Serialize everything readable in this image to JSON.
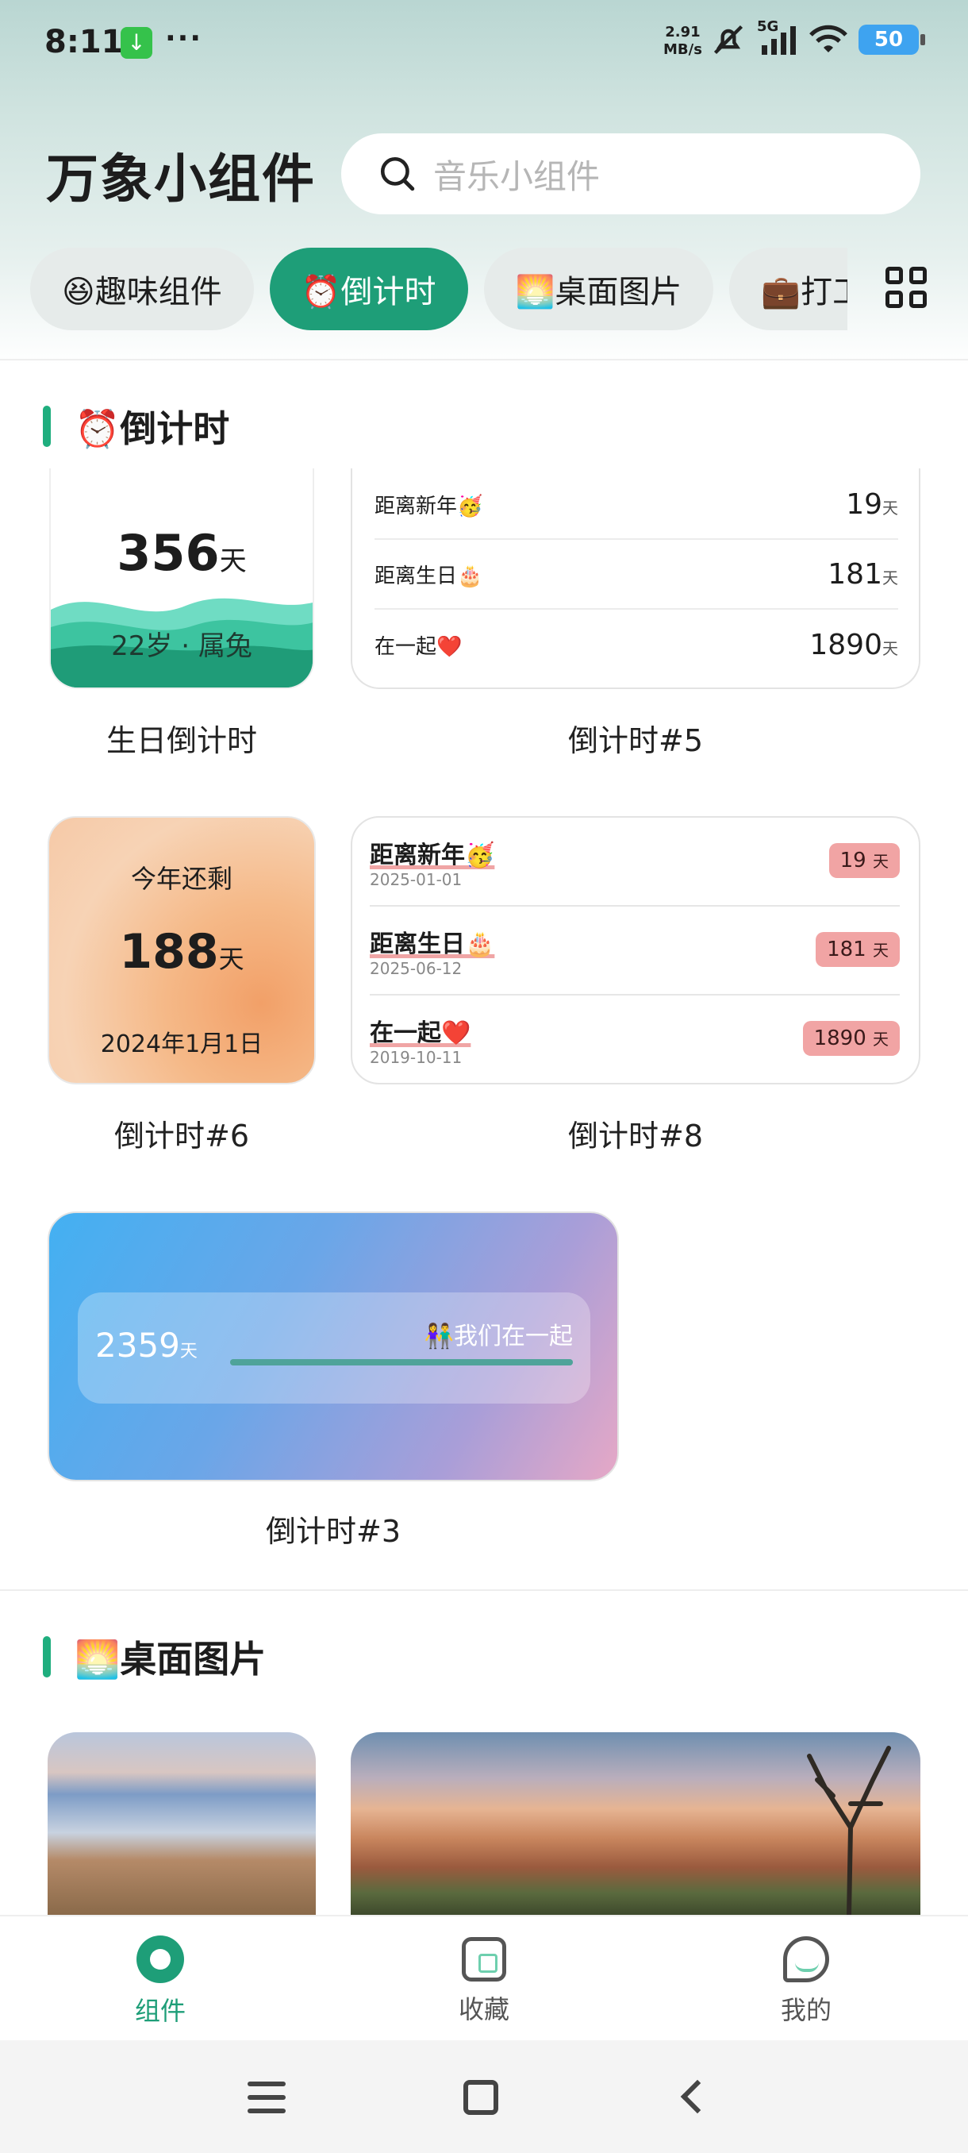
{
  "status_bar": {
    "time": "8:11",
    "download_glyph": "↓",
    "dots": "···",
    "net_speed": "2.91",
    "net_unit": "MB/s",
    "signal_label": "5G",
    "battery": "50"
  },
  "app": {
    "title": "万象小组件",
    "search_placeholder": "音乐小组件"
  },
  "tabs": [
    {
      "label": "😆趣味组件",
      "active": false
    },
    {
      "label": "⏰倒计时",
      "active": true
    },
    {
      "label": "🌅桌面图片",
      "active": false
    },
    {
      "label": "💼打工",
      "active": false
    }
  ],
  "countdown_section": {
    "title": "⏰倒计时",
    "birthday_widget": {
      "number": "356",
      "unit": "天",
      "sub": "22岁 · 属兔",
      "caption": "生日倒计时"
    },
    "widget5": {
      "caption": "倒计时#5",
      "rows": [
        {
          "label": "距离新年🥳",
          "value": "19",
          "unit": "天"
        },
        {
          "label": "距离生日🎂",
          "value": "181",
          "unit": "天"
        },
        {
          "label": "在一起❤️",
          "value": "1890",
          "unit": "天"
        }
      ]
    },
    "widget6": {
      "top_label": "今年还剩",
      "number": "188",
      "unit": "天",
      "date": "2024年1月1日",
      "caption": "倒计时#6"
    },
    "widget8": {
      "caption": "倒计时#8",
      "rows": [
        {
          "label": "距离新年🥳",
          "date": "2025-01-01",
          "value": "19",
          "unit": "天"
        },
        {
          "label": "距离生日🎂",
          "date": "2025-06-12",
          "value": "181",
          "unit": "天"
        },
        {
          "label": "在一起❤️",
          "date": "2019-10-11",
          "value": "1890",
          "unit": "天"
        }
      ]
    },
    "widget3": {
      "number": "2359",
      "unit": "天",
      "label": "👫我们在一起",
      "progress": 1.0,
      "caption": "倒计时#3"
    }
  },
  "images_section": {
    "title": "🌅桌面图片"
  },
  "bottom_nav": [
    {
      "label": "组件",
      "icon": "widget-icon",
      "active": true
    },
    {
      "label": "收藏",
      "icon": "favorites-icon",
      "active": false
    },
    {
      "label": "我的",
      "icon": "profile-icon",
      "active": false
    }
  ],
  "colors": {
    "accent": "#1e9e78",
    "badge": "#f1a4a4"
  }
}
